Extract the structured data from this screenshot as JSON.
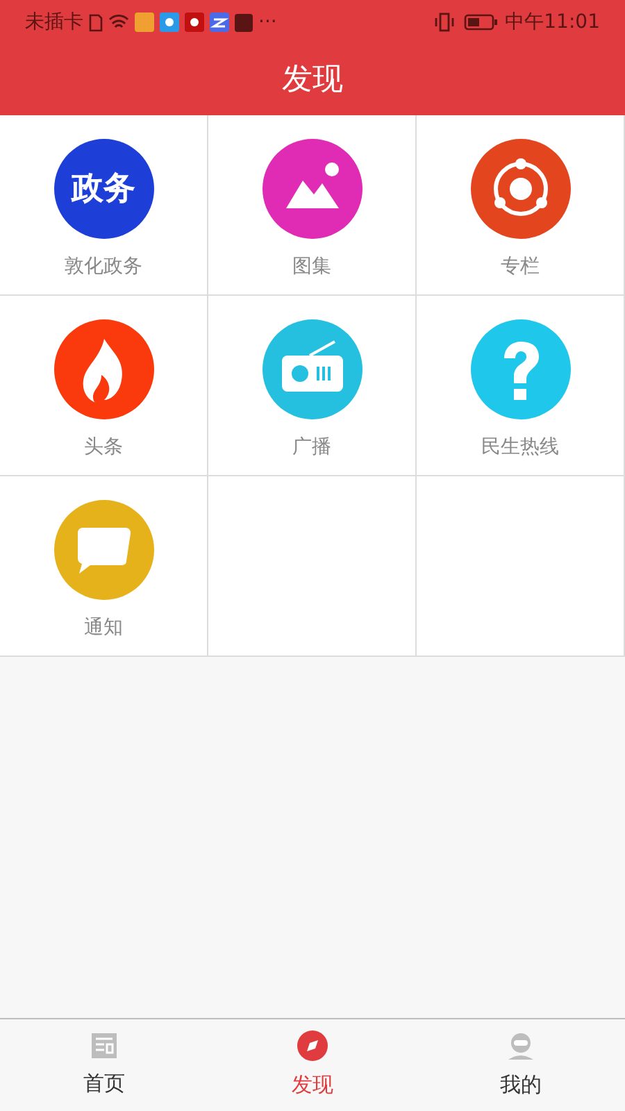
{
  "status_bar": {
    "carrier": "未插卡",
    "more": "···",
    "time": "中午11:01"
  },
  "header": {
    "title": "发现"
  },
  "grid": [
    {
      "label": "敦化政务",
      "kind": "text",
      "icon_text": "政务",
      "color": "#1d3fd8"
    },
    {
      "label": "图集",
      "kind": "picture",
      "color": "#e02bb5"
    },
    {
      "label": "专栏",
      "kind": "share",
      "color": "#e3451f"
    },
    {
      "label": "头条",
      "kind": "fire",
      "color": "#fa3a0c"
    },
    {
      "label": "广播",
      "kind": "radio",
      "color": "#25bfe0"
    },
    {
      "label": "民生热线",
      "kind": "question",
      "color": "#1fc8ea"
    },
    {
      "label": "通知",
      "kind": "message",
      "color": "#e6b21c"
    }
  ],
  "tabs": [
    {
      "label": "首页",
      "kind": "news",
      "selected": false
    },
    {
      "label": "发现",
      "kind": "compass",
      "selected": true
    },
    {
      "label": "我的",
      "kind": "user",
      "selected": false
    }
  ]
}
